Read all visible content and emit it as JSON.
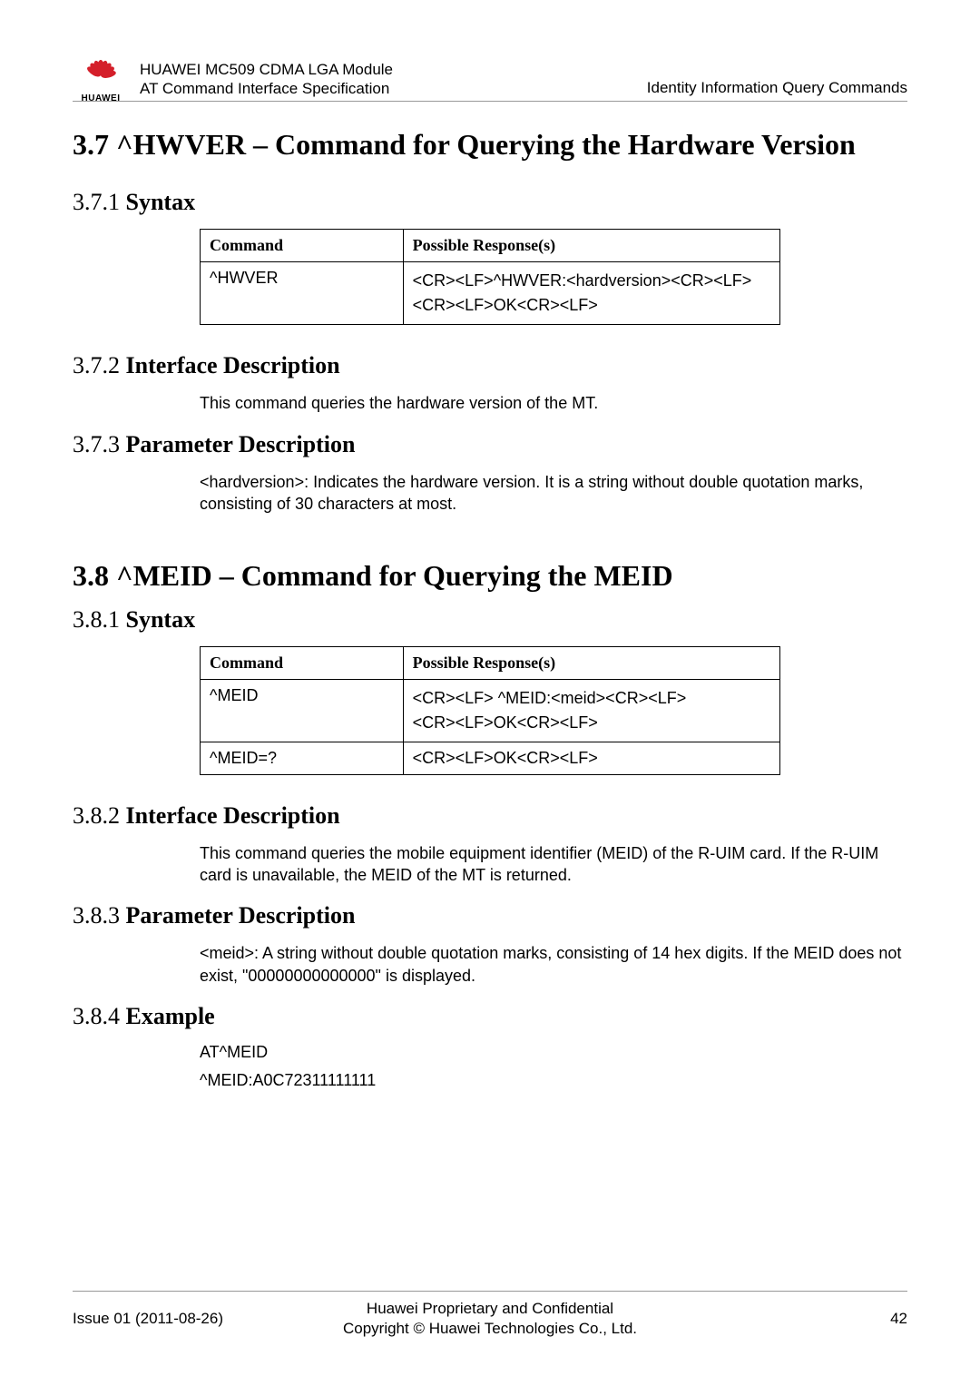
{
  "header": {
    "product_line1": "HUAWEI MC509 CDMA LGA Module",
    "product_line2": "AT Command Interface Specification",
    "chapter": "Identity Information Query Commands",
    "logo_text": "HUAWEI"
  },
  "sec37": {
    "heading": "3.7 ^HWVER – Command for Querying the Hardware Version",
    "s1": {
      "num": "3.7.1 ",
      "title": "Syntax"
    },
    "s2": {
      "num": "3.7.2 ",
      "title": "Interface Description"
    },
    "s3": {
      "num": "3.7.3 ",
      "title": "Parameter Description"
    },
    "table": {
      "h1": "Command",
      "h2": "Possible Response(s)",
      "r1c1": "^HWVER",
      "r1c2a": "<CR><LF>^HWVER:<hardversion><CR><LF>",
      "r1c2b": "<CR><LF>OK<CR><LF>"
    },
    "ifdesc": "This command queries the hardware version of the MT.",
    "paramdesc": "<hardversion>: Indicates the hardware version. It is a string without double quotation marks, consisting of 30 characters at most."
  },
  "sec38": {
    "heading": "3.8 ^MEID – Command for Querying the MEID",
    "s1": {
      "num": "3.8.1 ",
      "title": "Syntax"
    },
    "s2": {
      "num": "3.8.2 ",
      "title": "Interface Description"
    },
    "s3": {
      "num": "3.8.3 ",
      "title": "Parameter Description"
    },
    "s4": {
      "num": "3.8.4 ",
      "title": "Example"
    },
    "table": {
      "h1": "Command",
      "h2": "Possible Response(s)",
      "r1c1": "^MEID",
      "r1c2a": "<CR><LF> ^MEID:<meid><CR><LF>",
      "r1c2b": "<CR><LF>OK<CR><LF>",
      "r2c1": "^MEID=?",
      "r2c2": "<CR><LF>OK<CR><LF>"
    },
    "ifdesc": "This command queries the mobile equipment identifier (MEID) of the R-UIM card. If the R-UIM card is unavailable, the MEID of the MT is returned.",
    "paramdesc": "<meid>: A string without double quotation marks, consisting of 14 hex digits. If the MEID does not exist, \"00000000000000\" is displayed.",
    "example_l1": "AT^MEID",
    "example_l2": "^MEID:A0C72311111111"
  },
  "footer": {
    "left": "Issue 01 (2011-08-26)",
    "center_l1": "Huawei Proprietary and Confidential",
    "center_l2": "Copyright © Huawei Technologies Co., Ltd.",
    "right": "42"
  }
}
